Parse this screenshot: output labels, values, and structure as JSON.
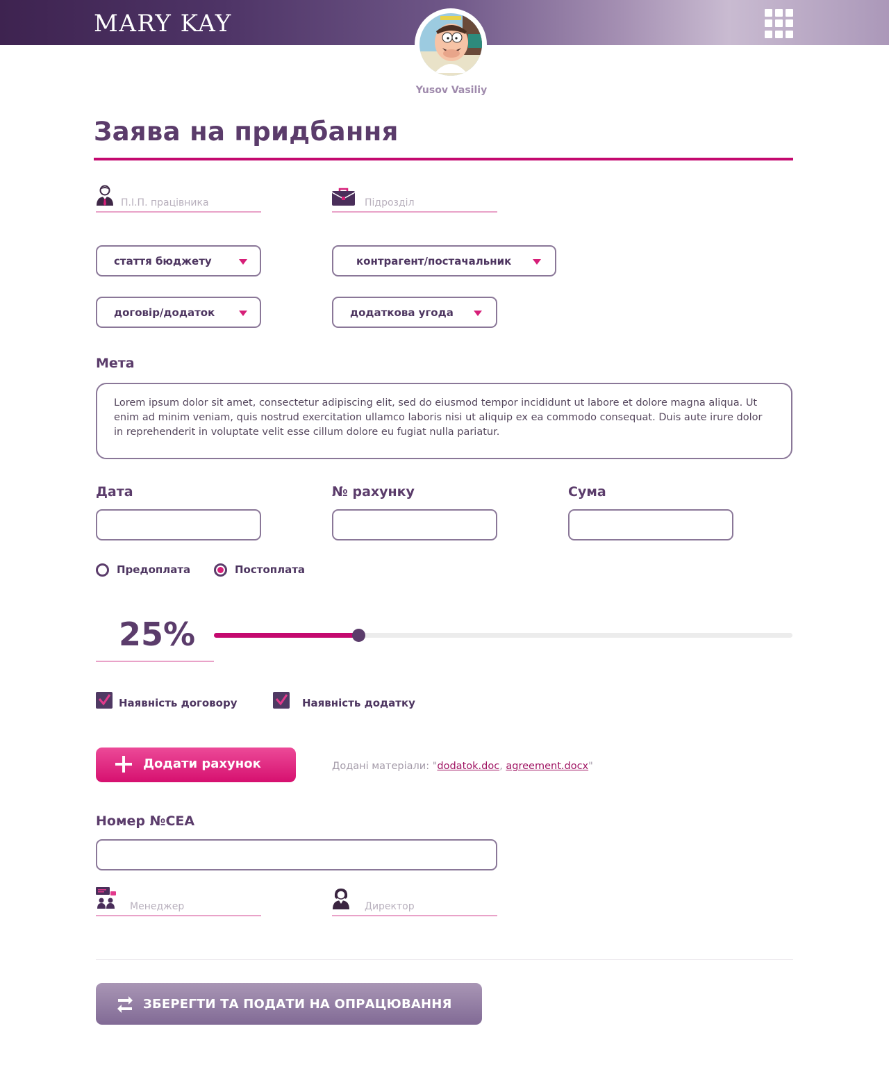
{
  "header": {
    "logo": "MARY KAY",
    "user_name": "Yusov Vasiliy"
  },
  "page": {
    "title": "Заява на придбання"
  },
  "fields": {
    "employee_placeholder": "П.І.П. працівника",
    "department_placeholder": "Підрозділ",
    "budget_item": "стаття бюджету",
    "counterparty": "контрагент/постачальник",
    "contract": "договір/додаток",
    "additional_agreement": "додаткова угода",
    "purpose_label": "Мета",
    "purpose_text": "Lorem ipsum dolor sit amet, consectetur adipiscing elit, sed do eiusmod tempor incididunt ut labore et dolore magna aliqua. Ut enim ad minim veniam, quis nostrud exercitation ullamco laboris nisi ut aliquip ex ea commodo consequat. Duis aute irure dolor in reprehenderit in voluptate velit esse cillum dolore eu fugiat nulla pariatur.",
    "date_label": "Дата",
    "invoice_label": "№ рахунку",
    "sum_label": "Сума",
    "cea_label": "Номер №CEA",
    "manager_placeholder": "Менеджер",
    "director_placeholder": "Директор"
  },
  "payment": {
    "prepay_label": "Предоплата",
    "postpay_label": "Постоплата",
    "selected": "Постоплата"
  },
  "progress": {
    "label": "25%",
    "value": 0.25
  },
  "checks": {
    "contract_label": "Наявність договору",
    "contract_checked": true,
    "appendix_label": "Наявність додатку",
    "appendix_checked": true
  },
  "attachments": {
    "button_label": "Додати рахунок",
    "prefix": "Додані матеріали: \"",
    "file1": "dodatok.doc",
    "separator": ", ",
    "file2": "agreement.docx",
    "suffix": "\""
  },
  "actions": {
    "submit_label": "ЗБЕРЕГТИ ТА ПОДАТИ НА ОПРАЦЮВАННЯ"
  },
  "colors": {
    "accent": "#c4096f",
    "primary": "#5b3c6b",
    "button_pink": "#d6106f",
    "button_purple": "#816a95"
  },
  "icons": {
    "apps": "apps-grid-icon",
    "employee": "employee-icon",
    "department": "briefcase-icon",
    "manager": "manager-icon",
    "director": "director-icon",
    "add": "plus-icon",
    "submit": "swap-arrows-icon"
  }
}
